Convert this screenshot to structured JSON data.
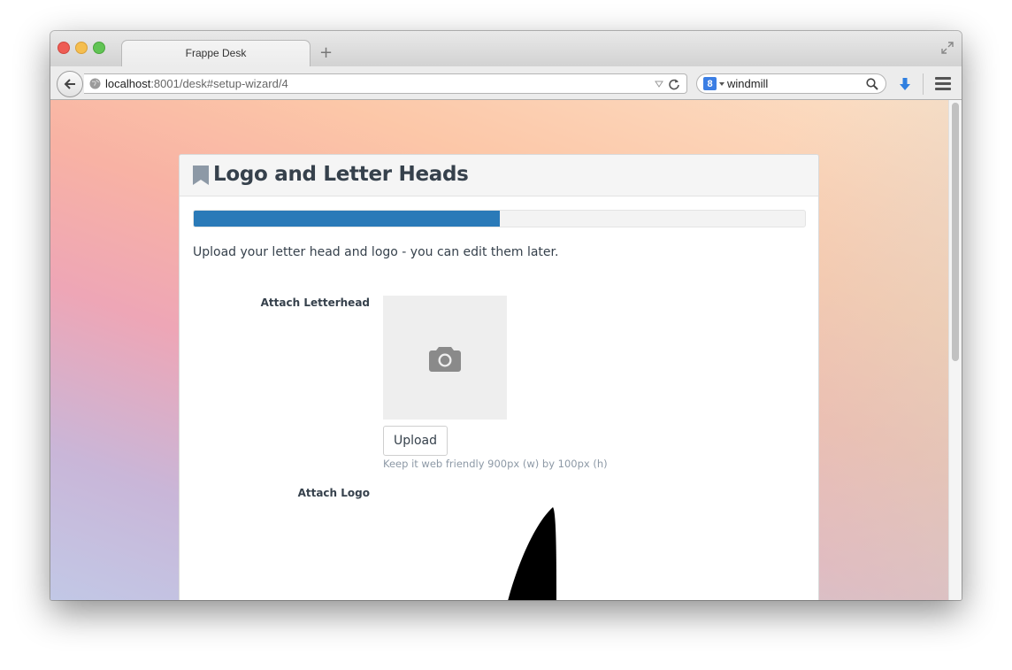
{
  "browser": {
    "tab_title": "Frappe Desk",
    "new_tab_label": "+",
    "url_host": "localhost",
    "url_rest": ":8001/desk#setup-wizard/4",
    "search_engine_letter": "8",
    "search_query": "windmill"
  },
  "wizard": {
    "title": "Logo and Letter Heads",
    "progress_percent": 50,
    "intro": "Upload your letter head and logo - you can edit them later.",
    "letterhead_label": "Attach Letterhead",
    "upload_label": "Upload",
    "letterhead_help": "Keep it web friendly 900px (w) by 100px (h)",
    "logo_label": "Attach Logo"
  },
  "colors": {
    "progress_fill": "#2a7ab8",
    "title_text": "#36414c",
    "help_text": "#8d99a6"
  },
  "icons": {
    "placeholder": "camera-icon",
    "header": "bookmark-icon",
    "logo_preview": "windmill-blade-shape"
  }
}
